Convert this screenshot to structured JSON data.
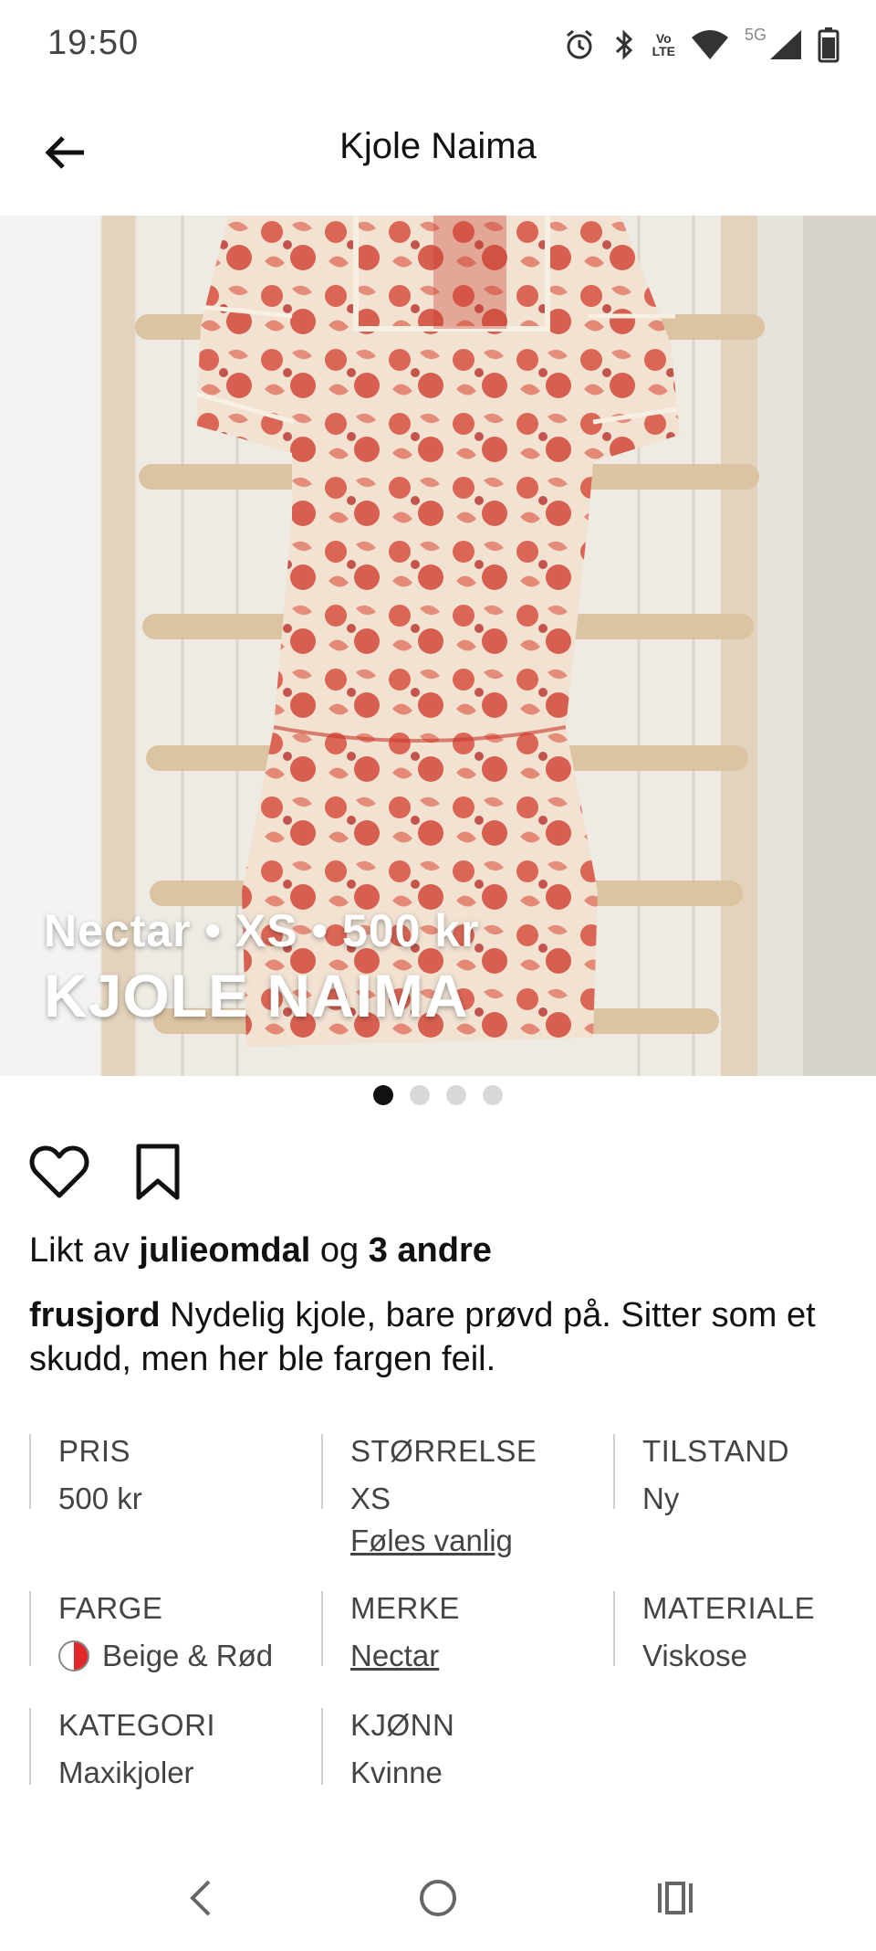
{
  "status_bar": {
    "time": "19:50",
    "vo_lte_top": "Vo",
    "vo_lte_bottom": "LTE",
    "network": "5G",
    "icons": [
      "alarm-icon",
      "bluetooth-icon",
      "volte-icon",
      "wifi-icon",
      "signal-icon",
      "battery-icon"
    ]
  },
  "header": {
    "title": "Kjole Naima",
    "back_icon": "arrow-left-icon"
  },
  "photo": {
    "subtitle": "Nectar • XS • 500 kr",
    "title": "KJOLE NAIMA",
    "page_count": 4,
    "active_page": 1
  },
  "actions": {
    "like_icon": "heart-icon",
    "save_icon": "bookmark-icon"
  },
  "likes": {
    "prefix": "Likt av ",
    "user": "julieomdal",
    "middle": " og ",
    "others": "3 andre"
  },
  "description": {
    "author": "frusjord",
    "text": " Nydelig kjole, bare prøvd på. Sitter som et skudd, men her ble fargen feil."
  },
  "attributes": {
    "price": {
      "label": "PRIS",
      "value": "500 kr"
    },
    "size": {
      "label": "STØRRELSE",
      "value": "XS",
      "fit": "Føles vanlig"
    },
    "condition": {
      "label": "TILSTAND",
      "value": "Ny"
    },
    "color": {
      "label": "FARGE",
      "value": "Beige & Rød",
      "swatch_colors": [
        "#ffffff",
        "#e0282a"
      ]
    },
    "brand": {
      "label": "MERKE",
      "value": "Nectar"
    },
    "material": {
      "label": "MATERIALE",
      "value": "Viskose"
    },
    "category": {
      "label": "KATEGORI",
      "value": "Maxikjoler"
    },
    "gender": {
      "label": "KJØNN",
      "value": "Kvinne"
    }
  },
  "nav": {
    "back_icon": "nav-back-icon",
    "home_icon": "nav-home-icon",
    "recents_icon": "nav-recents-icon"
  },
  "colors": {
    "text": "#111111",
    "muted": "#444444",
    "dress_red": "#d94a3a",
    "dress_beige": "#f3e6d8"
  }
}
